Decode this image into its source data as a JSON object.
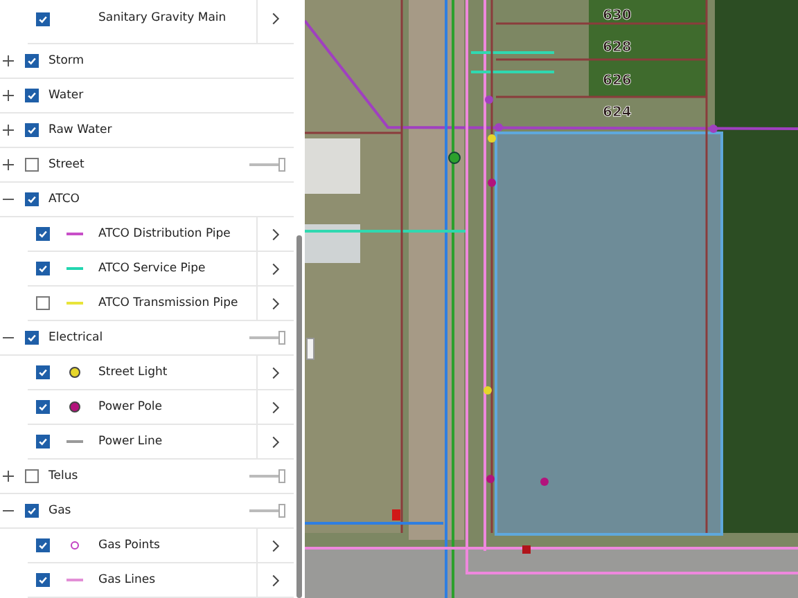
{
  "layers": [
    {
      "kind": "child",
      "checked": true,
      "label": "Sanitary Gravity Main"
    },
    {
      "kind": "group",
      "expanded": false,
      "checked": true,
      "label": "Storm"
    },
    {
      "kind": "group",
      "expanded": false,
      "checked": true,
      "label": "Water"
    },
    {
      "kind": "group",
      "expanded": false,
      "checked": true,
      "label": "Raw Water"
    },
    {
      "kind": "group",
      "expanded": false,
      "checked": false,
      "label": "Street",
      "level": 1
    },
    {
      "kind": "group",
      "expanded": true,
      "checked": true,
      "label": "ATCO"
    },
    {
      "kind": "child",
      "checked": true,
      "label": "ATCO Distribution Pipe",
      "symbol": {
        "kind": "line",
        "color": "#c84fc8"
      }
    },
    {
      "kind": "child",
      "checked": true,
      "label": "ATCO Service Pipe",
      "symbol": {
        "kind": "line",
        "color": "#22d6b0"
      }
    },
    {
      "kind": "child",
      "checked": false,
      "label": "ATCO Transmission Pipe",
      "symbol": {
        "kind": "line",
        "color": "#e8e43a"
      }
    },
    {
      "kind": "group",
      "expanded": true,
      "checked": true,
      "label": "Electrical",
      "level": 1
    },
    {
      "kind": "child",
      "checked": true,
      "label": "Street Light",
      "symbol": {
        "kind": "dot",
        "color": "#e6d62a"
      }
    },
    {
      "kind": "child",
      "checked": true,
      "label": "Power Pole",
      "symbol": {
        "kind": "dot",
        "color": "#b3137c"
      }
    },
    {
      "kind": "child",
      "checked": true,
      "label": "Power Line",
      "symbol": {
        "kind": "line",
        "color": "#9a9a9a"
      }
    },
    {
      "kind": "group",
      "expanded": false,
      "checked": false,
      "label": "Telus",
      "level": 1
    },
    {
      "kind": "group",
      "expanded": true,
      "checked": true,
      "label": "Gas",
      "level": 1
    },
    {
      "kind": "child",
      "checked": true,
      "label": "Gas Points",
      "symbol": {
        "kind": "ring",
        "color": "#c23fc2"
      }
    },
    {
      "kind": "child",
      "checked": true,
      "label": "Gas Lines",
      "symbol": {
        "kind": "line",
        "color": "#e28fd6"
      }
    }
  ],
  "map": {
    "lot_labels": [
      "630",
      "628",
      "626",
      "624"
    ]
  }
}
